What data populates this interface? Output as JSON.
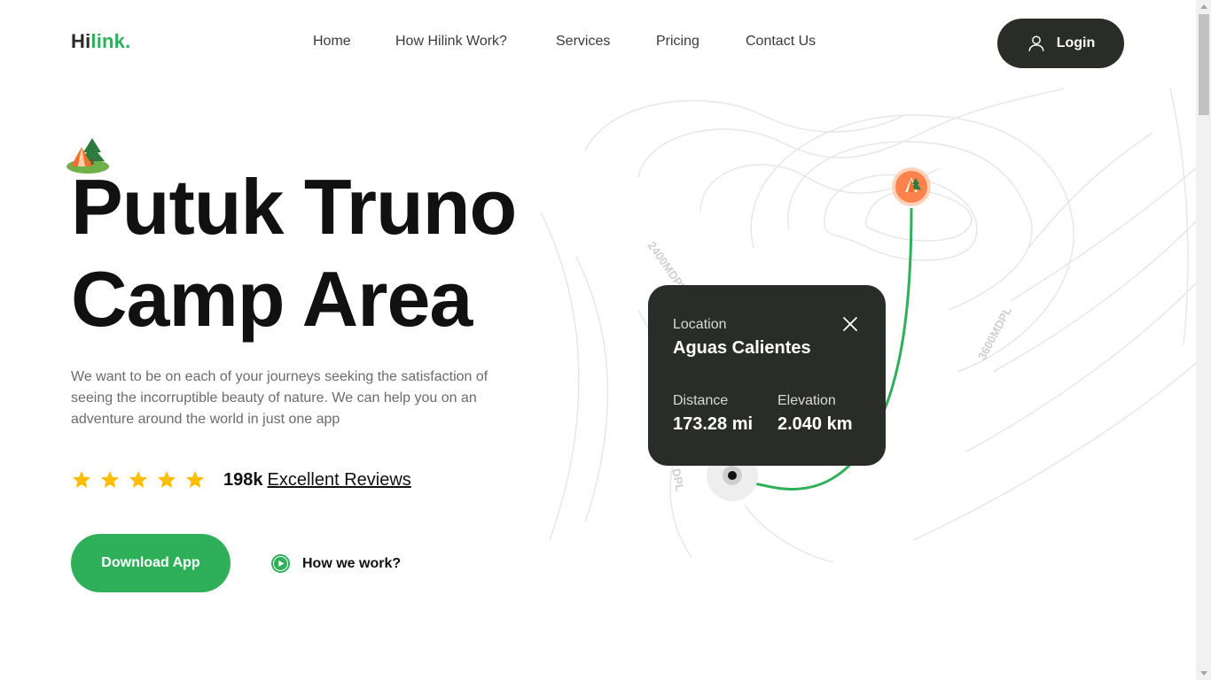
{
  "header": {
    "logo_prefix": "Hi",
    "logo_suffix": "link.",
    "nav": [
      {
        "label": "Home"
      },
      {
        "label": "How Hilink Work?"
      },
      {
        "label": "Services"
      },
      {
        "label": "Pricing"
      },
      {
        "label": "Contact Us"
      }
    ],
    "login_label": "Login"
  },
  "hero": {
    "title_line1": "Putuk Truno",
    "title_line2": "Camp Area",
    "description": "We want to be on each of your journeys seeking the satisfaction of seeing the incorruptible beauty of nature. We can help you on an adventure around the world in just one app",
    "rating": {
      "stars": 5,
      "count": "198k",
      "link_text": "Excellent Reviews"
    },
    "download_label": "Download App",
    "how_label": "How we work?"
  },
  "map": {
    "contour_labels": [
      "2400MDPL",
      "3600MDPL",
      "DPL"
    ],
    "card": {
      "location_label": "Location",
      "location_value": "Aguas Calientes",
      "distance_label": "Distance",
      "distance_value": "173.28 mi",
      "elevation_label": "Elevation",
      "elevation_value": "2.040 km"
    }
  },
  "colors": {
    "accent": "#30af5b",
    "dark": "#292c27",
    "star": "#febd00",
    "pin": "#ff814c"
  },
  "icons": {
    "login": "user-icon",
    "star": "star-icon",
    "play": "play-icon",
    "close": "close-icon",
    "camp": "camp-icon",
    "pin": "location-pin-icon"
  }
}
